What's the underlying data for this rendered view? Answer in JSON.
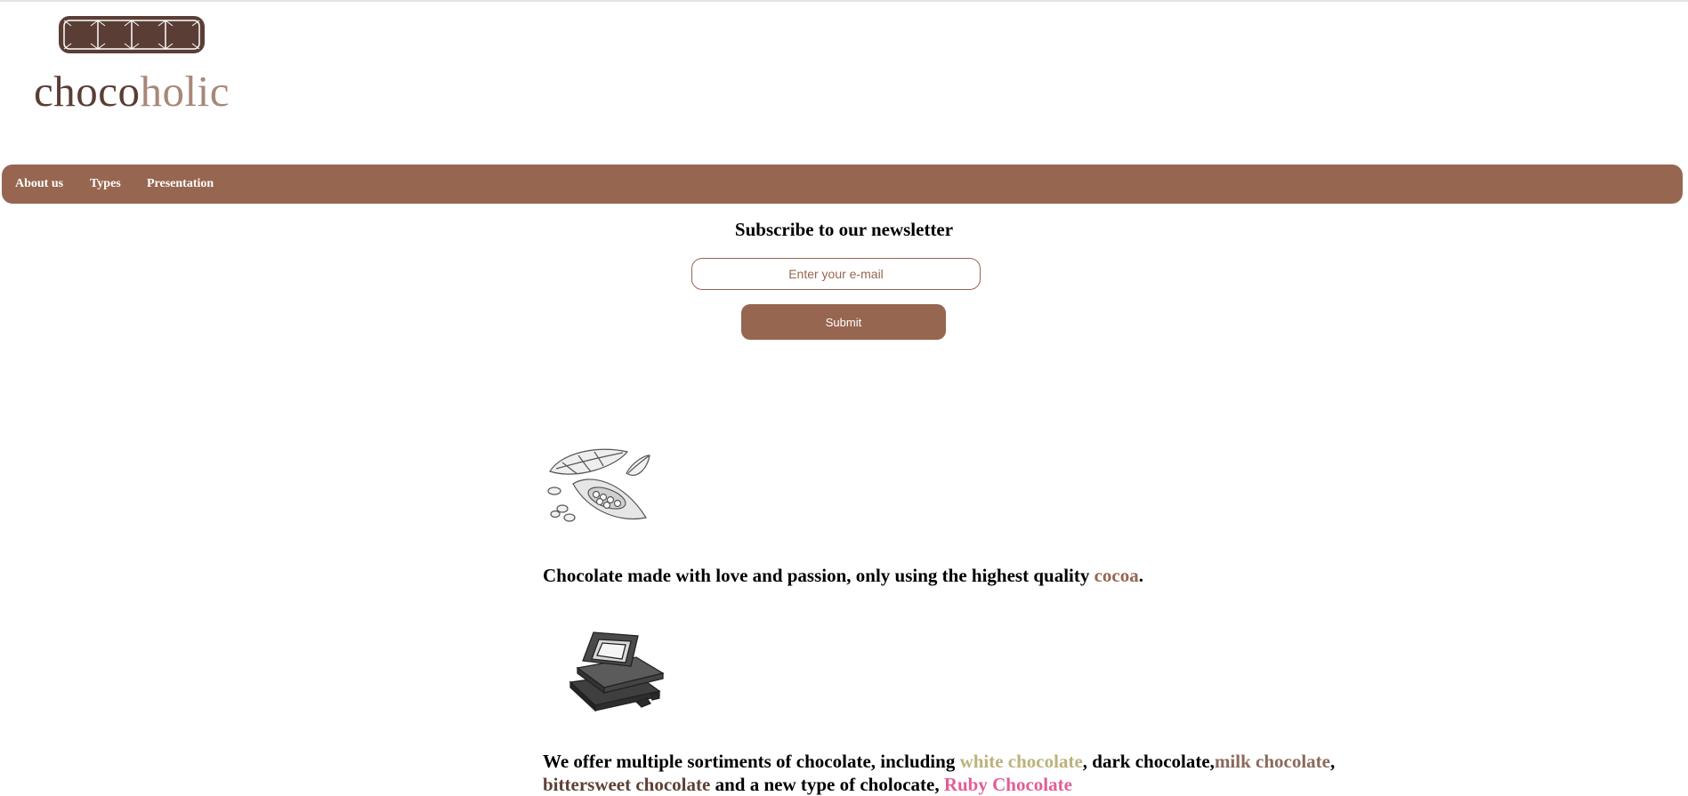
{
  "logo": {
    "text_part1": "choco",
    "text_part2": "holic",
    "icon": "chocolate-bar-icon",
    "colors": {
      "dark": "#5a3e36",
      "light": "#a8877b"
    }
  },
  "nav": {
    "items": [
      {
        "label": "About us"
      },
      {
        "label": "Types"
      },
      {
        "label": "Presentation"
      }
    ],
    "background": "#976650"
  },
  "newsletter": {
    "title": "Subscribe to our newsletter",
    "email_placeholder": "Enter your e-mail",
    "email_value": "",
    "submit_label": "Submit"
  },
  "section1": {
    "illustration": "cocoa-pods-icon",
    "text_before": "Chocolate made with love and passion, only using the highest quality ",
    "highlight": "cocoa",
    "text_after": "."
  },
  "section2": {
    "illustration": "chocolate-bars-stack-icon",
    "t1": "We offer multiple sortiments of chocolate, including ",
    "white": "white chocolate",
    "t2": ", dark chocolate,",
    "milk": "milk chocolate",
    "t3": ", ",
    "bitter": "bittersweet chocolate",
    "t4": " and a new type of cholocate, ",
    "ruby": "Ruby Chocolate"
  },
  "colors": {
    "accent": "#976650",
    "white_chocolate": "#bcb27b",
    "milk_chocolate": "#8a6a5c",
    "bittersweet": "#5e4035",
    "ruby": "#e25d96"
  }
}
